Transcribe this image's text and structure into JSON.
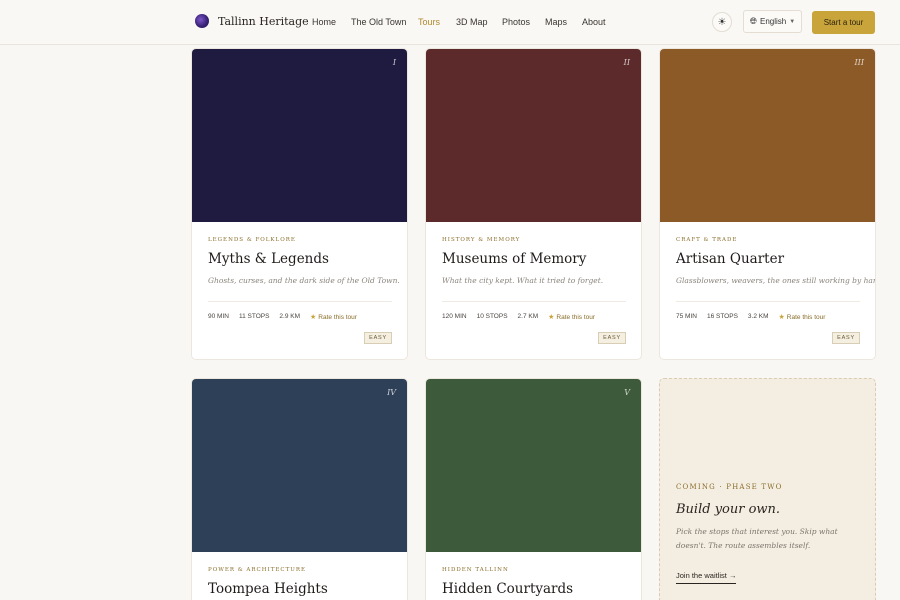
{
  "header": {
    "brand": "Tallinn Heritage",
    "nav": [
      {
        "label": "Home"
      },
      {
        "label": "The Old Town"
      },
      {
        "label": "Tours",
        "active": true
      },
      {
        "label": "3D Map"
      },
      {
        "label": "Photos"
      },
      {
        "label": "Maps"
      },
      {
        "label": "About"
      }
    ],
    "theme_icon": "sun-icon",
    "language": "English",
    "cta": "Start a tour"
  },
  "tours": [
    {
      "numeral": "I",
      "category": "Legends & Folklore",
      "title": "Myths & Legends",
      "description": "Ghosts, curses, and the dark side of the Old Town.",
      "duration": "90 MIN",
      "stops": "11 STOPS",
      "distance": "2.9 KM",
      "rate_label": "Rate this tour",
      "difficulty": "EASY",
      "color": "#1e1a40"
    },
    {
      "numeral": "II",
      "category": "History & Memory",
      "title": "Museums of Memory",
      "description": "What the city kept. What it tried to forget.",
      "duration": "120 MIN",
      "stops": "10 STOPS",
      "distance": "2.7 KM",
      "rate_label": "Rate this tour",
      "difficulty": "EASY",
      "color": "#5c2a2a"
    },
    {
      "numeral": "III",
      "category": "Craft & Trade",
      "title": "Artisan Quarter",
      "description": "Glassblowers, weavers, the ones still working by hand.",
      "duration": "75 MIN",
      "stops": "16 STOPS",
      "distance": "3.2 KM",
      "rate_label": "Rate this tour",
      "difficulty": "EASY",
      "color": "#8c5a26"
    },
    {
      "numeral": "IV",
      "category": "Power & Architecture",
      "title": "Toompea Heights",
      "color": "#2e3f58"
    },
    {
      "numeral": "V",
      "category": "Hidden Tallinn",
      "title": "Hidden Courtyards",
      "color": "#3d5a3a"
    }
  ],
  "coming_soon": {
    "eyebrow": "Coming · Phase Two",
    "heading": "Build your own.",
    "body": "Pick the stops that interest you. Skip what doesn't. The route assembles itself.",
    "link": "Join the waitlist →"
  }
}
